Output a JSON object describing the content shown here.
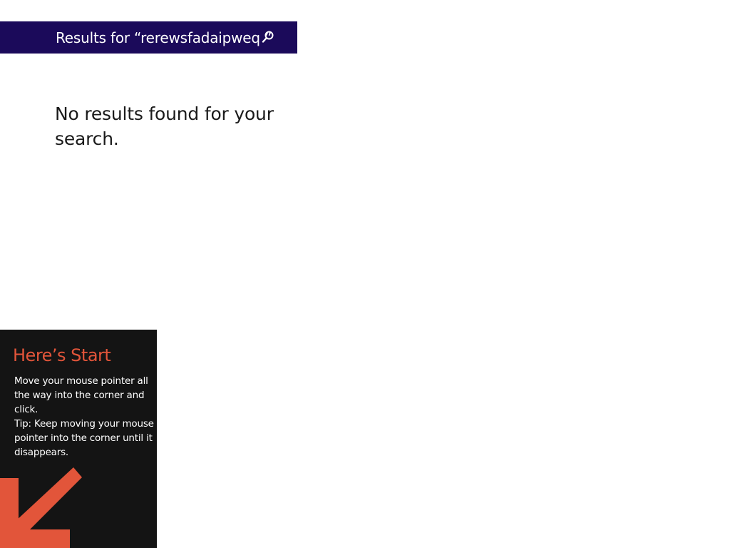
{
  "search": {
    "header_text": "Results for “rerewsfadaipweq ”",
    "no_results_message": "No results found for your search.",
    "header_color": "#1b0a5a"
  },
  "start_tip": {
    "title": "Here’s Start",
    "line1": "Move your mouse pointer all the way into the corner and click.",
    "line2": "Tip: Keep moving your mouse pointer into the corner until it disappears.",
    "title_color": "#e2553a",
    "arrow_color": "#e2553a",
    "arrow_icon": "arrow-down-left-icon"
  }
}
